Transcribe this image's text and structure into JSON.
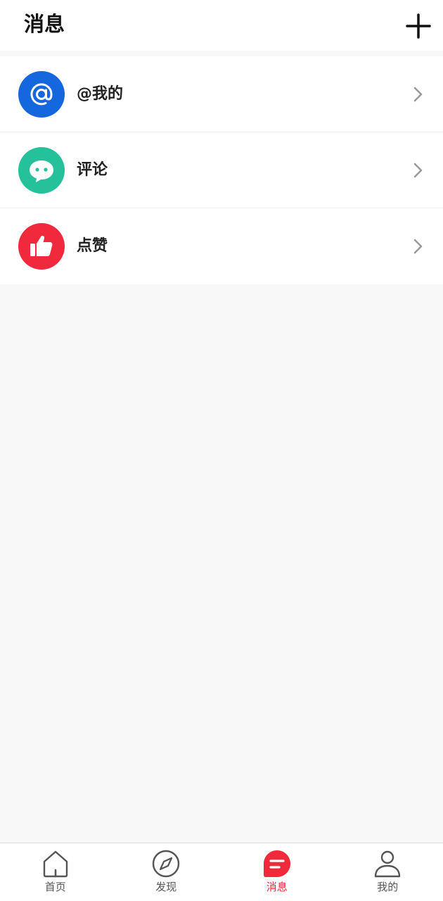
{
  "header": {
    "title": "消息",
    "add_icon": "plus-icon"
  },
  "messages": {
    "items": [
      {
        "label": "@我的",
        "icon": "at-icon",
        "color": "#1467dc"
      },
      {
        "label": "评论",
        "icon": "comment-bubble-icon",
        "color": "#25c19a"
      },
      {
        "label": "点赞",
        "icon": "thumbs-up-icon",
        "color": "#f0293c"
      }
    ],
    "chevron_icon": "chevron-right-icon"
  },
  "tabbar": {
    "active_color": "#f0293c",
    "items": [
      {
        "label": "首页",
        "icon": "home-icon",
        "active": false
      },
      {
        "label": "发现",
        "icon": "compass-icon",
        "active": false
      },
      {
        "label": "消息",
        "icon": "message-icon",
        "active": true
      },
      {
        "label": "我的",
        "icon": "user-icon",
        "active": false
      }
    ]
  }
}
